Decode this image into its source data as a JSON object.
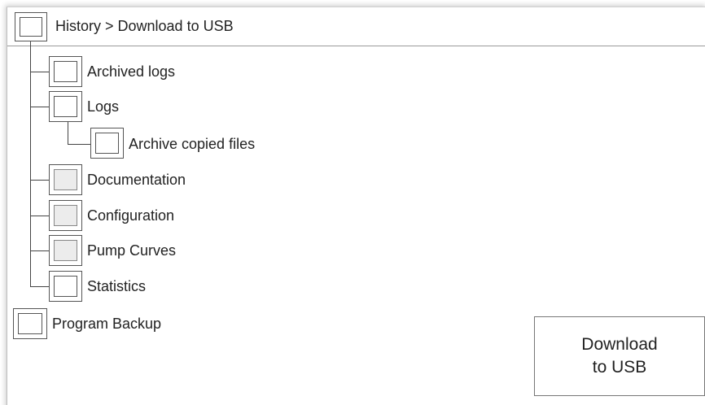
{
  "header": {
    "title": "History > Download to USB"
  },
  "tree": {
    "items": [
      {
        "label": "Archived logs"
      },
      {
        "label": "Logs"
      },
      {
        "label": "Archive copied files"
      },
      {
        "label": "Documentation"
      },
      {
        "label": "Configuration"
      },
      {
        "label": "Pump Curves"
      },
      {
        "label": "Statistics"
      }
    ]
  },
  "program_backup": {
    "label": "Program Backup"
  },
  "download_button": {
    "line1": "Download",
    "line2": "to USB"
  }
}
